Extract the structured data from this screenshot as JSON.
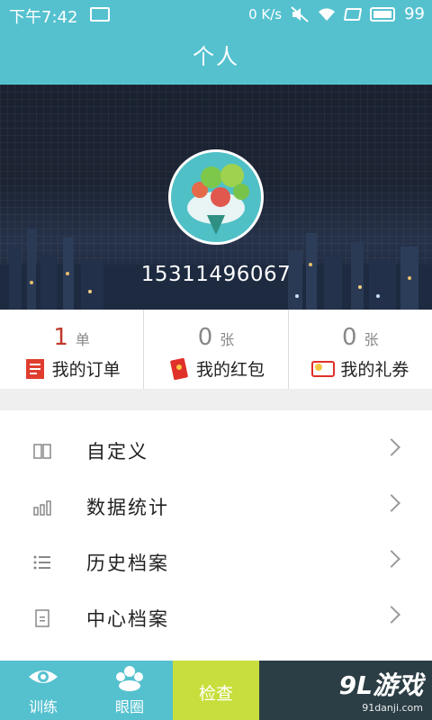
{
  "status_bar": {
    "time": "下午7:42",
    "network_speed": "0 K/s",
    "battery": "99"
  },
  "header": {
    "title": "个人"
  },
  "profile": {
    "phone": "15311496067"
  },
  "stats": [
    {
      "count": "1",
      "unit": "单",
      "label": "我的订单",
      "icon": "order-icon",
      "count_color": "#c0392b"
    },
    {
      "count": "0",
      "unit": "张",
      "label": "我的红包",
      "icon": "red-packet-icon",
      "count_color": "#888888"
    },
    {
      "count": "0",
      "unit": "张",
      "label": "我的礼券",
      "icon": "coupon-icon",
      "count_color": "#888888"
    }
  ],
  "menu": [
    {
      "label": "自定义",
      "icon": "book-icon"
    },
    {
      "label": "数据统计",
      "icon": "bar-chart-icon"
    },
    {
      "label": "历史档案",
      "icon": "list-icon"
    },
    {
      "label": "中心档案",
      "icon": "document-icon"
    }
  ],
  "tabs": [
    {
      "label": "训练",
      "icon": "eye-icon"
    },
    {
      "label": "眼圈",
      "icon": "community-icon"
    },
    {
      "label": "检查",
      "icon": ""
    },
    {
      "label": "",
      "icon": ""
    },
    {
      "label": "",
      "icon": ""
    }
  ],
  "watermark": {
    "brand": "9L游戏",
    "url": "91danji.com"
  },
  "colors": {
    "primary": "#55c1cf",
    "active_tab": "#c8de3c"
  }
}
